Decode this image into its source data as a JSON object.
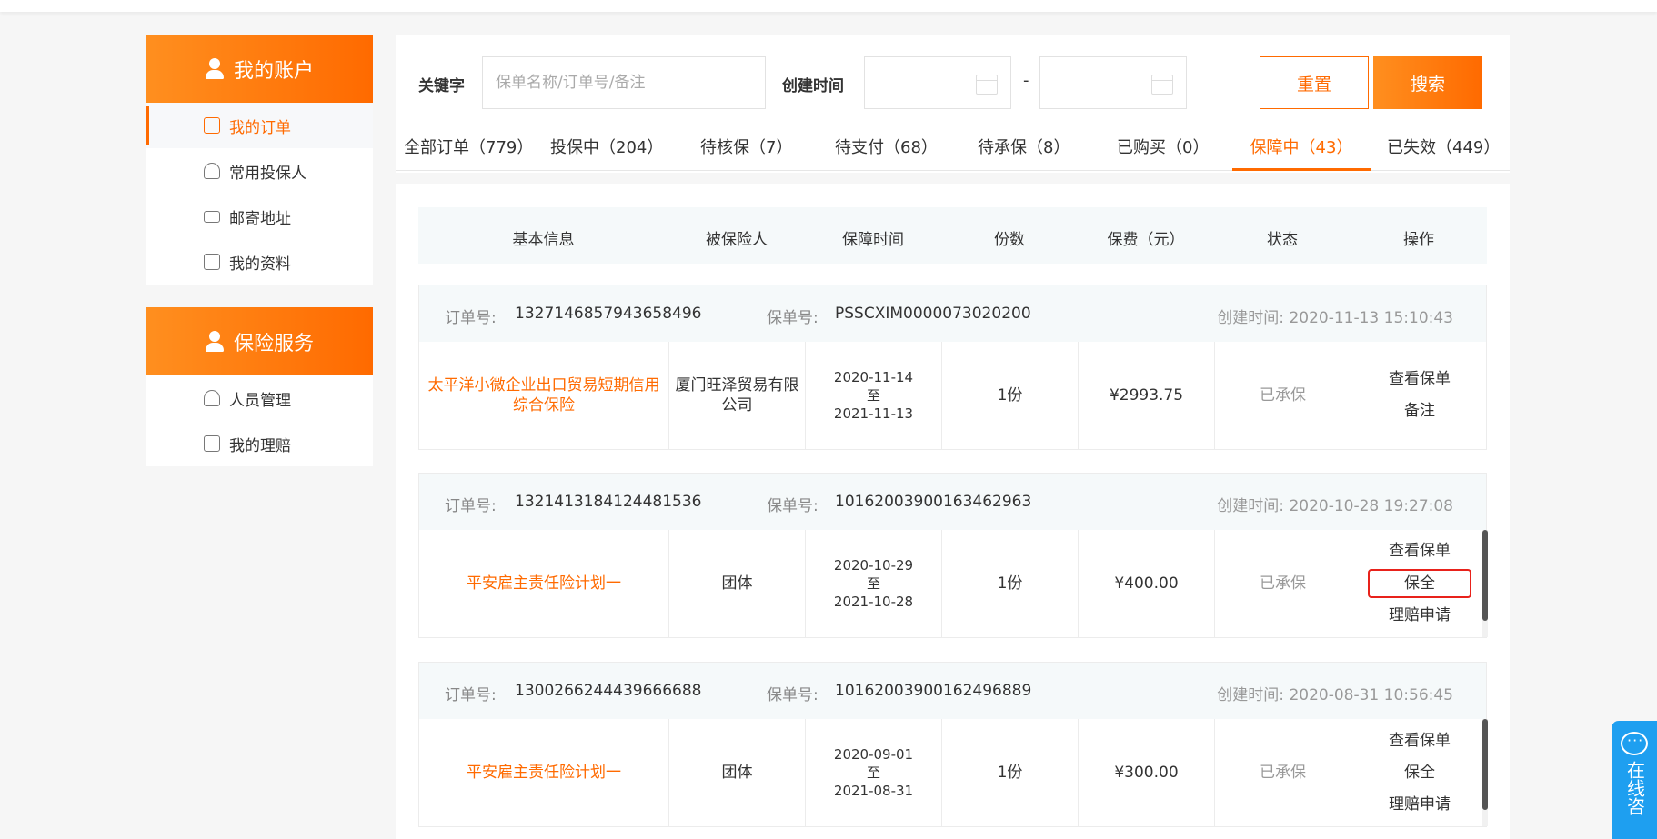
{
  "sidebar": {
    "account": {
      "title": "我的账户",
      "items": [
        {
          "label": "我的订单"
        },
        {
          "label": "常用投保人"
        },
        {
          "label": "邮寄地址"
        },
        {
          "label": "我的资料"
        }
      ]
    },
    "service": {
      "title": "保险服务",
      "items": [
        {
          "label": "人员管理"
        },
        {
          "label": "我的理赔"
        }
      ]
    }
  },
  "search": {
    "keyword_label": "关键字",
    "keyword_placeholder": "保单名称/订单号/备注",
    "created_label": "创建时间",
    "separator": "-",
    "reset_label": "重置",
    "search_label": "搜索"
  },
  "tabs": [
    {
      "label": "全部订单（779）"
    },
    {
      "label": "投保中（204）"
    },
    {
      "label": "待核保（7）"
    },
    {
      "label": "待支付（68）"
    },
    {
      "label": "待承保（8）"
    },
    {
      "label": "已购买（0）"
    },
    {
      "label": "保障中（43）"
    },
    {
      "label": "已失效（449）"
    }
  ],
  "table": {
    "headers": [
      "基本信息",
      "被保险人",
      "保障时间",
      "份数",
      "保费（元）",
      "状态",
      "操作"
    ]
  },
  "order_labels": {
    "order_no": "订单号:",
    "policy_no": "保单号:",
    "created": "创建时间:",
    "date_to": "至"
  },
  "orders": [
    {
      "order_no": "1327146857943658496",
      "policy_no": "PSSCXIM0000073020200",
      "created_time": "2020-11-13 15:10:43",
      "product": "太平洋小微企业出口贸易短期信用综合保险",
      "insured": "厦门旺泽贸易有限公司",
      "start": "2020-11-14",
      "end": "2021-11-13",
      "copies": "1份",
      "premium": "¥2993.75",
      "status": "已承保",
      "ops": [
        "查看保单",
        "备注"
      ]
    },
    {
      "order_no": "1321413184124481536",
      "policy_no": "10162003900163462963",
      "created_time": "2020-10-28 19:27:08",
      "product": "平安雇主责任险计划一",
      "insured": "团体",
      "start": "2020-10-29",
      "end": "2021-10-28",
      "copies": "1份",
      "premium": "¥400.00",
      "status": "已承保",
      "ops": [
        "查看保单",
        "保全",
        "理赔申请"
      ]
    },
    {
      "order_no": "1300266244439666688",
      "policy_no": "10162003900162496889",
      "created_time": "2020-08-31 10:56:45",
      "product": "平安雇主责任险计划一",
      "insured": "团体",
      "start": "2020-09-01",
      "end": "2021-08-31",
      "copies": "1份",
      "premium": "¥300.00",
      "status": "已承保",
      "ops": [
        "查看保单",
        "保全",
        "理赔申请"
      ]
    }
  ],
  "chat": {
    "label": "在线咨"
  }
}
